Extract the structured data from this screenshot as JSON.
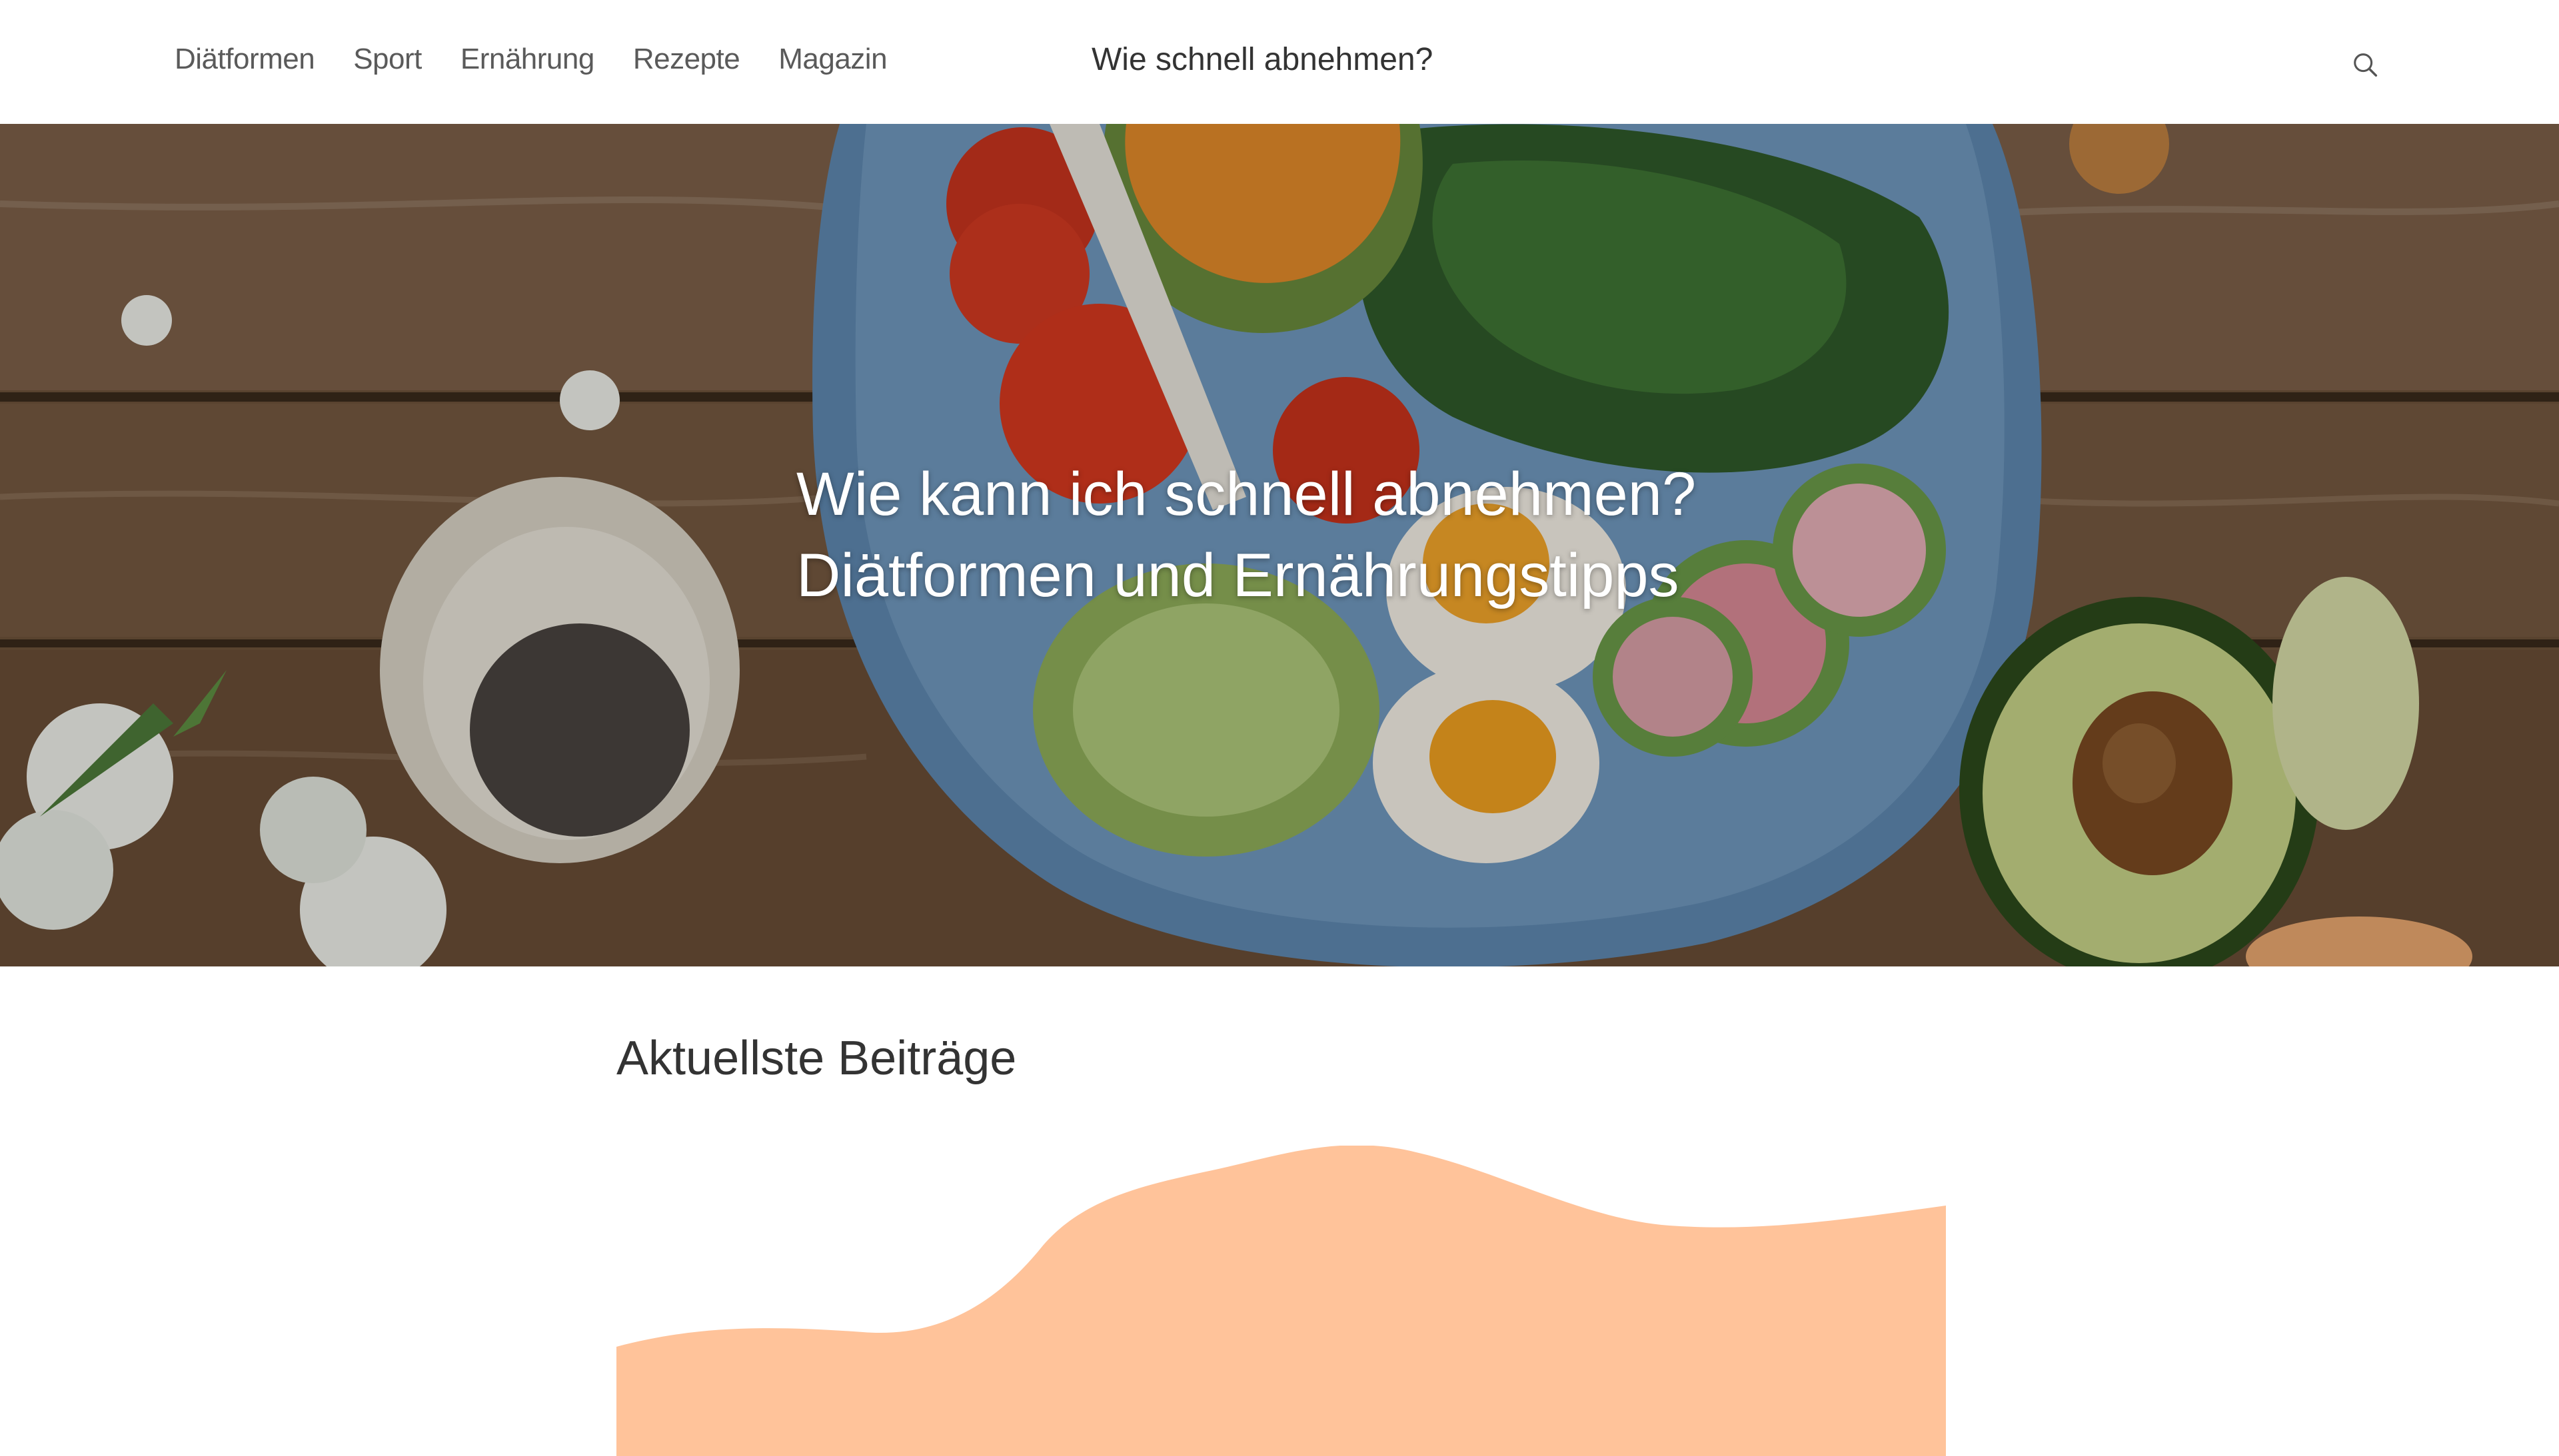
{
  "nav": {
    "items": [
      {
        "label": "Diätformen"
      },
      {
        "label": "Sport"
      },
      {
        "label": "Ernährung"
      },
      {
        "label": "Rezepte"
      },
      {
        "label": "Magazin"
      }
    ]
  },
  "header": {
    "site_title": "Wie schnell abnehmen?",
    "search_icon": "search-icon"
  },
  "hero": {
    "line1": "Wie kann ich schnell abnehmen?",
    "line2": "Diätformen und Ernährungstipps",
    "image": "food-bowl-on-wooden-table"
  },
  "main": {
    "section_title": "Aktuellste Beiträge"
  },
  "colors": {
    "accent_blob": "#ffc39a",
    "hero_wood": "#6a5038",
    "bowl_blue": "#5e88b0",
    "text_dark": "#333333",
    "nav_text": "#5a5a5a"
  }
}
